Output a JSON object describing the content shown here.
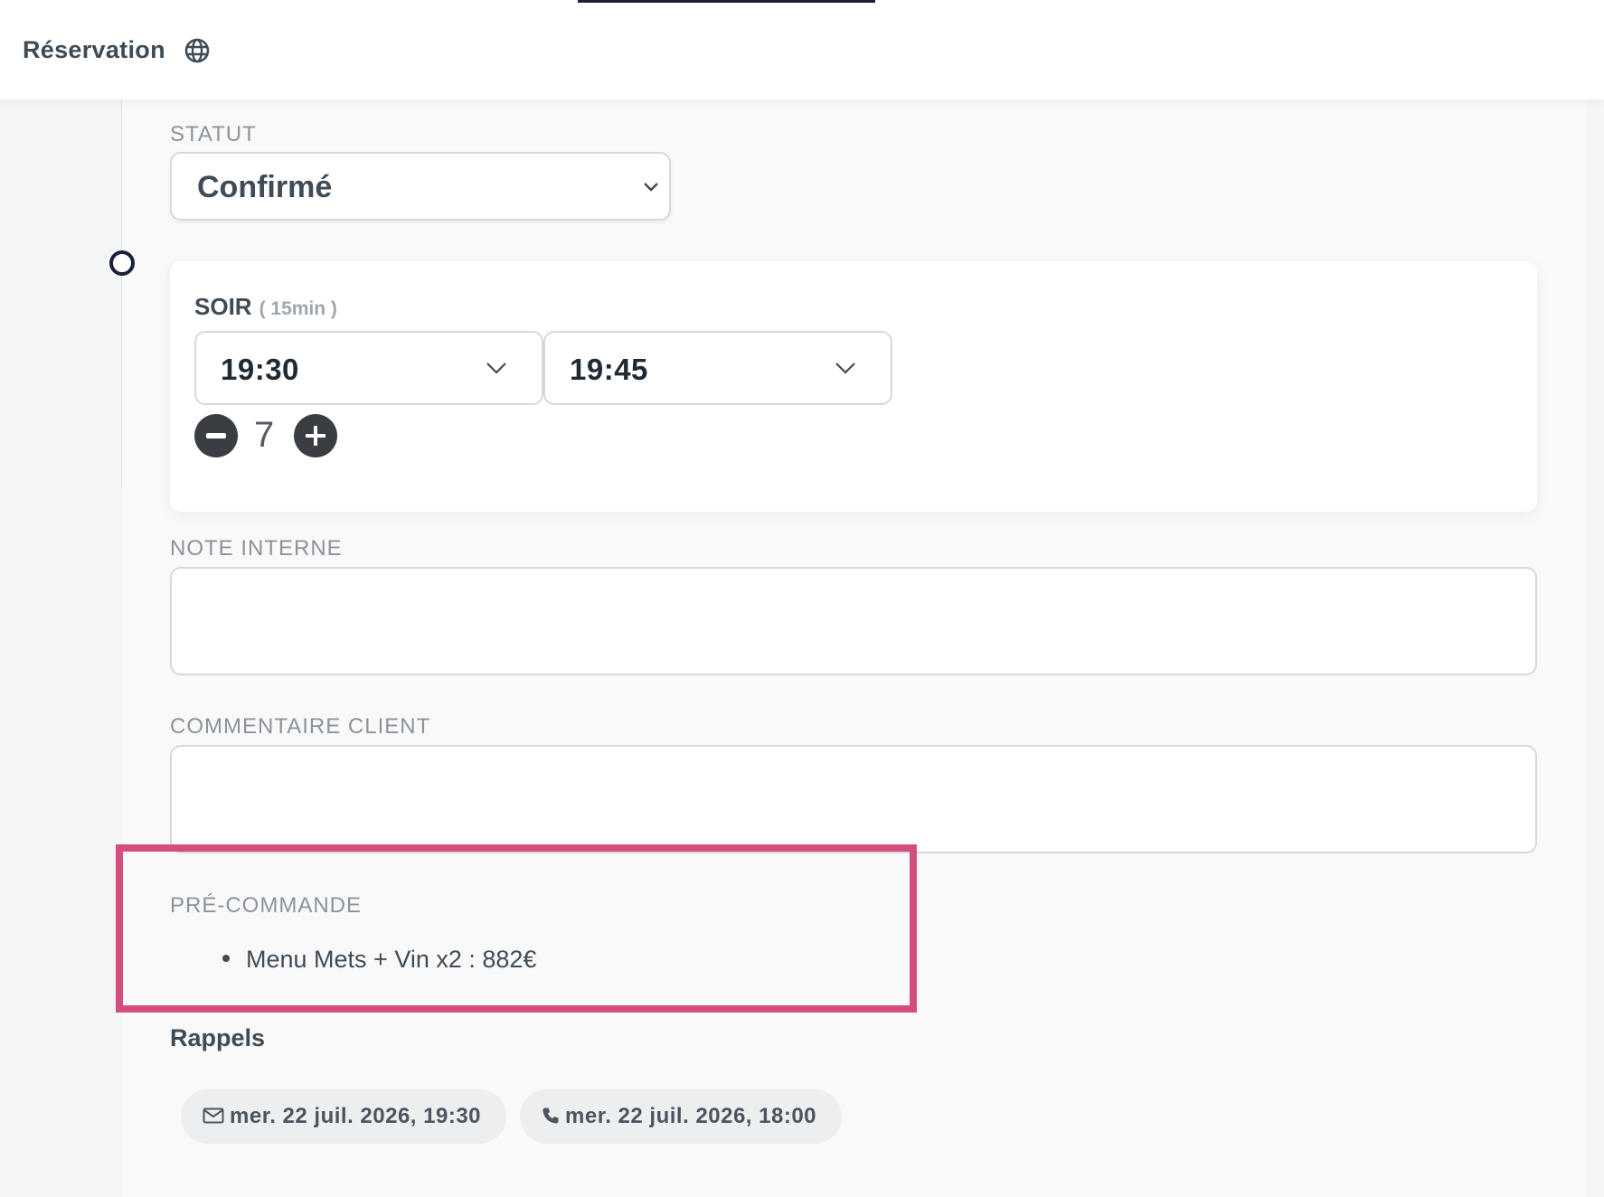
{
  "header": {
    "title": "Réservation",
    "language_icon": "globe-icon"
  },
  "status": {
    "label": "STATUT",
    "selected": "Confirmé"
  },
  "service": {
    "name": "SOIR",
    "duration": "( 15min )",
    "start_time": "19:30",
    "end_time": "19:45",
    "guest_count": "7"
  },
  "note_interne": {
    "label": "NOTE INTERNE",
    "value": ""
  },
  "commentaire_client": {
    "label": "COMMENTAIRE CLIENT",
    "value": ""
  },
  "pre_commande": {
    "label": "PRÉ-COMMANDE",
    "items": [
      "Menu Mets + Vin x2 : 882€"
    ]
  },
  "rappels": {
    "title": "Rappels",
    "items": [
      {
        "icon": "envelope-icon",
        "text": "mer. 22 juil. 2026, 19:30"
      },
      {
        "icon": "phone-icon",
        "text": "mer. 22 juil. 2026, 18:00"
      }
    ]
  },
  "colors": {
    "highlight": "#d44d7e",
    "accent_dark": "#1b1f3b",
    "stepper": "#3a3d42"
  }
}
